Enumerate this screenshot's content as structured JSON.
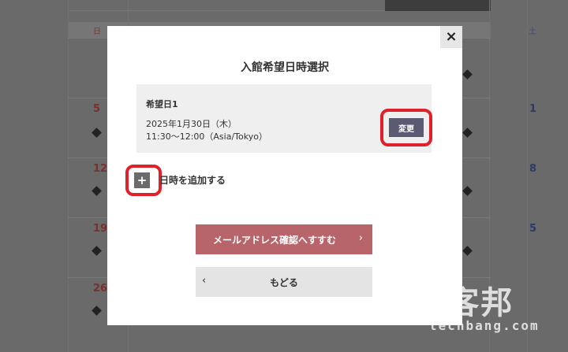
{
  "background_calendar": {
    "weekday_sun": "日",
    "weekday_sat": "土",
    "rows": [
      {
        "sun": "",
        "sat": ""
      },
      {
        "sun": "5",
        "sat": "1"
      },
      {
        "sun": "12",
        "sat": "8"
      },
      {
        "sun": "19",
        "sat": "5"
      },
      {
        "sun": "26",
        "sat": ""
      }
    ]
  },
  "modal": {
    "title": "入館希望日時選択",
    "close_label": "×",
    "date_entry": {
      "label": "希望日1",
      "date": "2025年1月30日（木）",
      "time": "11:30〜12:00（Asia/Tokyo）",
      "change_label": "変更"
    },
    "add_icon": "+",
    "add_label": "日時を追加する",
    "next_label": "メールアドレス確認へすすむ",
    "next_chevron": "›",
    "back_label": "もどる",
    "back_chevron": "‹"
  },
  "watermark": {
    "logo": "T客邦",
    "domain": "techbang.com"
  },
  "colors": {
    "accent": "#b7646b",
    "highlight": "#e0202a",
    "change_button": "#5a5a72"
  }
}
